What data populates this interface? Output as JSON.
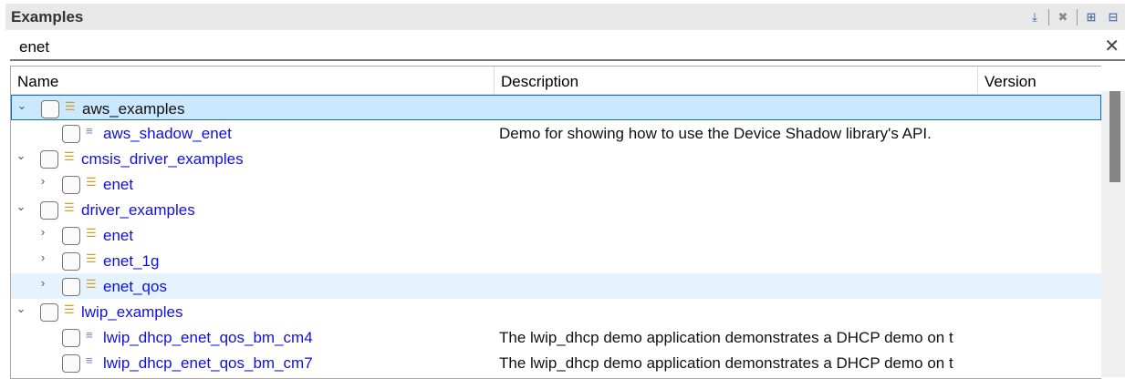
{
  "panel": {
    "title": "Examples"
  },
  "search": {
    "value": "enet"
  },
  "columns": [
    "Name",
    "Description",
    "Version"
  ],
  "rows": [
    {
      "name": "aws_examples",
      "level": 0,
      "expander": "expanded",
      "icon": "folder",
      "desc": ""
    },
    {
      "name": "aws_shadow_enet",
      "level": 1,
      "expander": "none",
      "icon": "file",
      "desc": "Demo for showing how to use the Device Shadow library's API."
    },
    {
      "name": "cmsis_driver_examples",
      "level": 0,
      "expander": "expanded",
      "icon": "folder",
      "desc": ""
    },
    {
      "name": "enet",
      "level": 1,
      "expander": "collapsed",
      "icon": "folder",
      "desc": ""
    },
    {
      "name": "driver_examples",
      "level": 0,
      "expander": "expanded",
      "icon": "folder",
      "desc": ""
    },
    {
      "name": "enet",
      "level": 1,
      "expander": "collapsed",
      "icon": "folder",
      "desc": ""
    },
    {
      "name": "enet_1g",
      "level": 1,
      "expander": "collapsed",
      "icon": "folder",
      "desc": ""
    },
    {
      "name": "enet_qos",
      "level": 1,
      "expander": "collapsed",
      "icon": "folder",
      "desc": ""
    },
    {
      "name": "lwip_examples",
      "level": 0,
      "expander": "expanded",
      "icon": "folder",
      "desc": ""
    },
    {
      "name": "lwip_dhcp_enet_qos_bm_cm4",
      "level": 1,
      "expander": "none",
      "icon": "file",
      "desc": "The lwip_dhcp demo application demonstrates a DHCP demo on t"
    },
    {
      "name": "lwip_dhcp_enet_qos_bm_cm7",
      "level": 1,
      "expander": "none",
      "icon": "file",
      "desc": "The lwip_dhcp demo application demonstrates a DHCP demo on t"
    }
  ]
}
